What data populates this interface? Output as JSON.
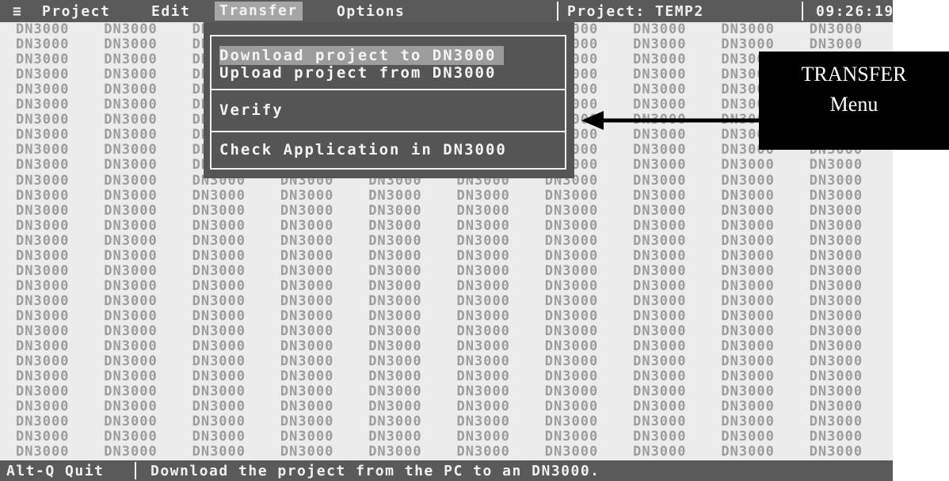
{
  "menubar": {
    "menu_icon": "≡",
    "items": [
      "Project",
      "Edit",
      "Transfer",
      "Options"
    ],
    "active": "Transfer",
    "project_label": "Project: TEMP2",
    "time": "09:26:19"
  },
  "background_text": "DN3000",
  "dropdown": {
    "items": [
      "Download project to DN3000",
      "Upload project from DN3000",
      "Verify",
      "Check Application in DN3000"
    ],
    "selected": "Download project to DN3000"
  },
  "statusbar": {
    "shortcut": "Alt-Q Quit",
    "message": "Download the project from the PC to an DN3000."
  },
  "callout": {
    "line1": "TRANSFER",
    "line2": "Menu"
  },
  "colors": {
    "bar": "#5a5a5a",
    "screen": "#ececec",
    "grid_text": "#9c9c9c",
    "highlight": "#9c9c9c"
  }
}
